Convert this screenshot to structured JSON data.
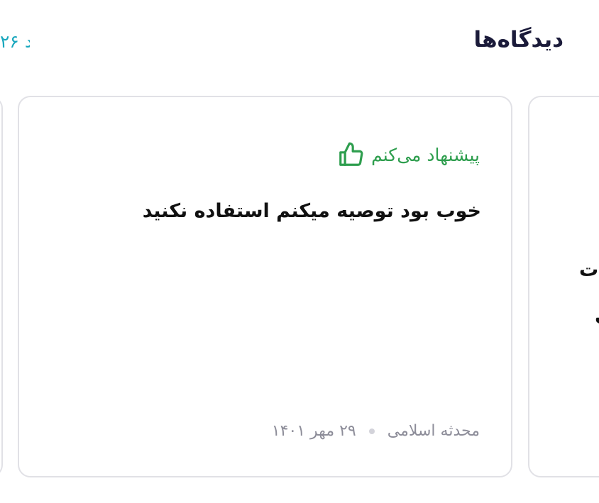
{
  "header": {
    "title": "دیدگاه‌ها",
    "count_fragment": "۲۶ د"
  },
  "review": {
    "recommendation": "پیشنهاد می‌کنم",
    "recommendation_icon": "thumbs-up-icon",
    "text": "خوب بود توصیه میکنم استفاده نکنید",
    "date": "۲۹ مهر ۱۴۰۱",
    "author": "محدثه اسلامی"
  },
  "next_card": {
    "line_1": "ت",
    "line_2": "ی"
  },
  "colors": {
    "title": "#1b1b3a",
    "count": "#19a7bd",
    "recommend": "#2e9e4e",
    "meta": "#8d8d99",
    "card_border": "#e1e1e6"
  }
}
